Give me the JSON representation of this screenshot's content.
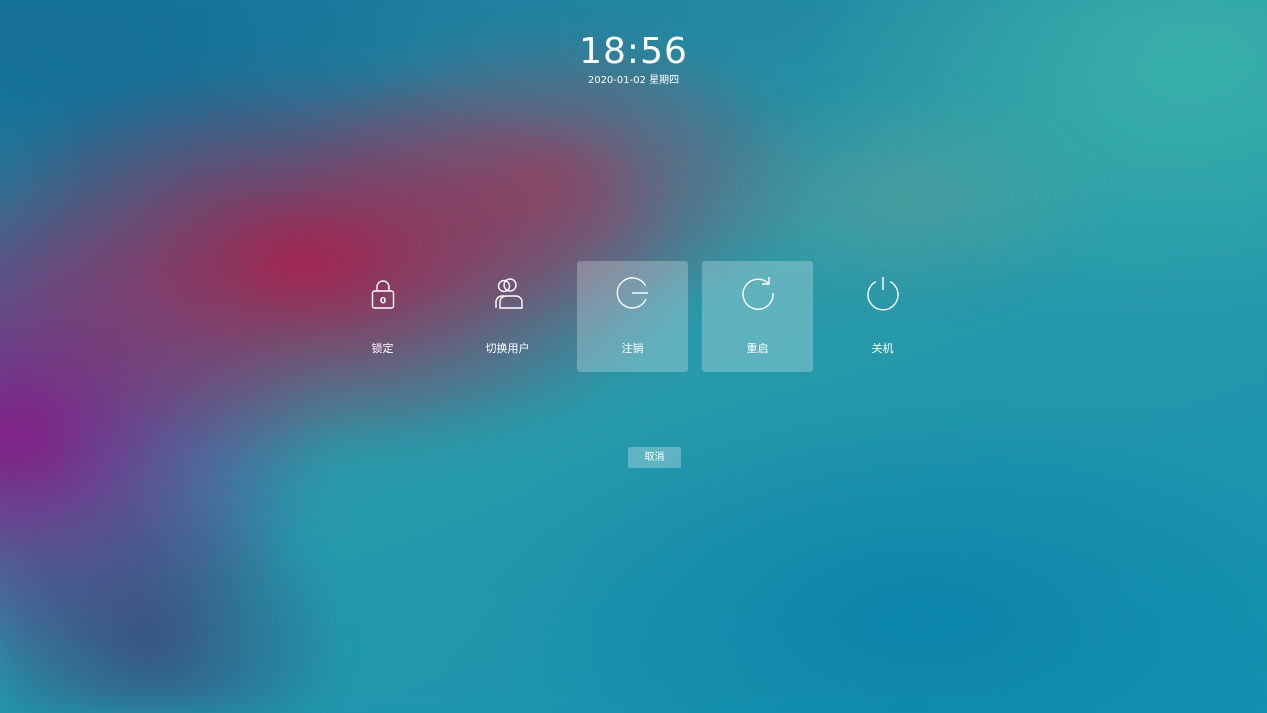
{
  "clock": {
    "time": "18:56",
    "date": "2020-01-02 星期四"
  },
  "actions": [
    {
      "id": "lock",
      "label": "锁定",
      "icon": "lock-icon",
      "highlighted": false
    },
    {
      "id": "switch-user",
      "label": "切换用户",
      "icon": "users-icon",
      "highlighted": false
    },
    {
      "id": "logout",
      "label": "注销",
      "icon": "logout-icon",
      "highlighted": true
    },
    {
      "id": "reboot",
      "label": "重启",
      "icon": "reboot-icon",
      "highlighted": true
    },
    {
      "id": "shutdown",
      "label": "关机",
      "icon": "power-icon",
      "highlighted": false
    }
  ],
  "lock_icon_text": "0",
  "cancel": {
    "label": "取消"
  },
  "colors": {
    "text": "#ffffff",
    "button_bg": "rgba(255,255,255,0.28)",
    "highlight_bg": "rgba(255,255,255,0.25)"
  }
}
